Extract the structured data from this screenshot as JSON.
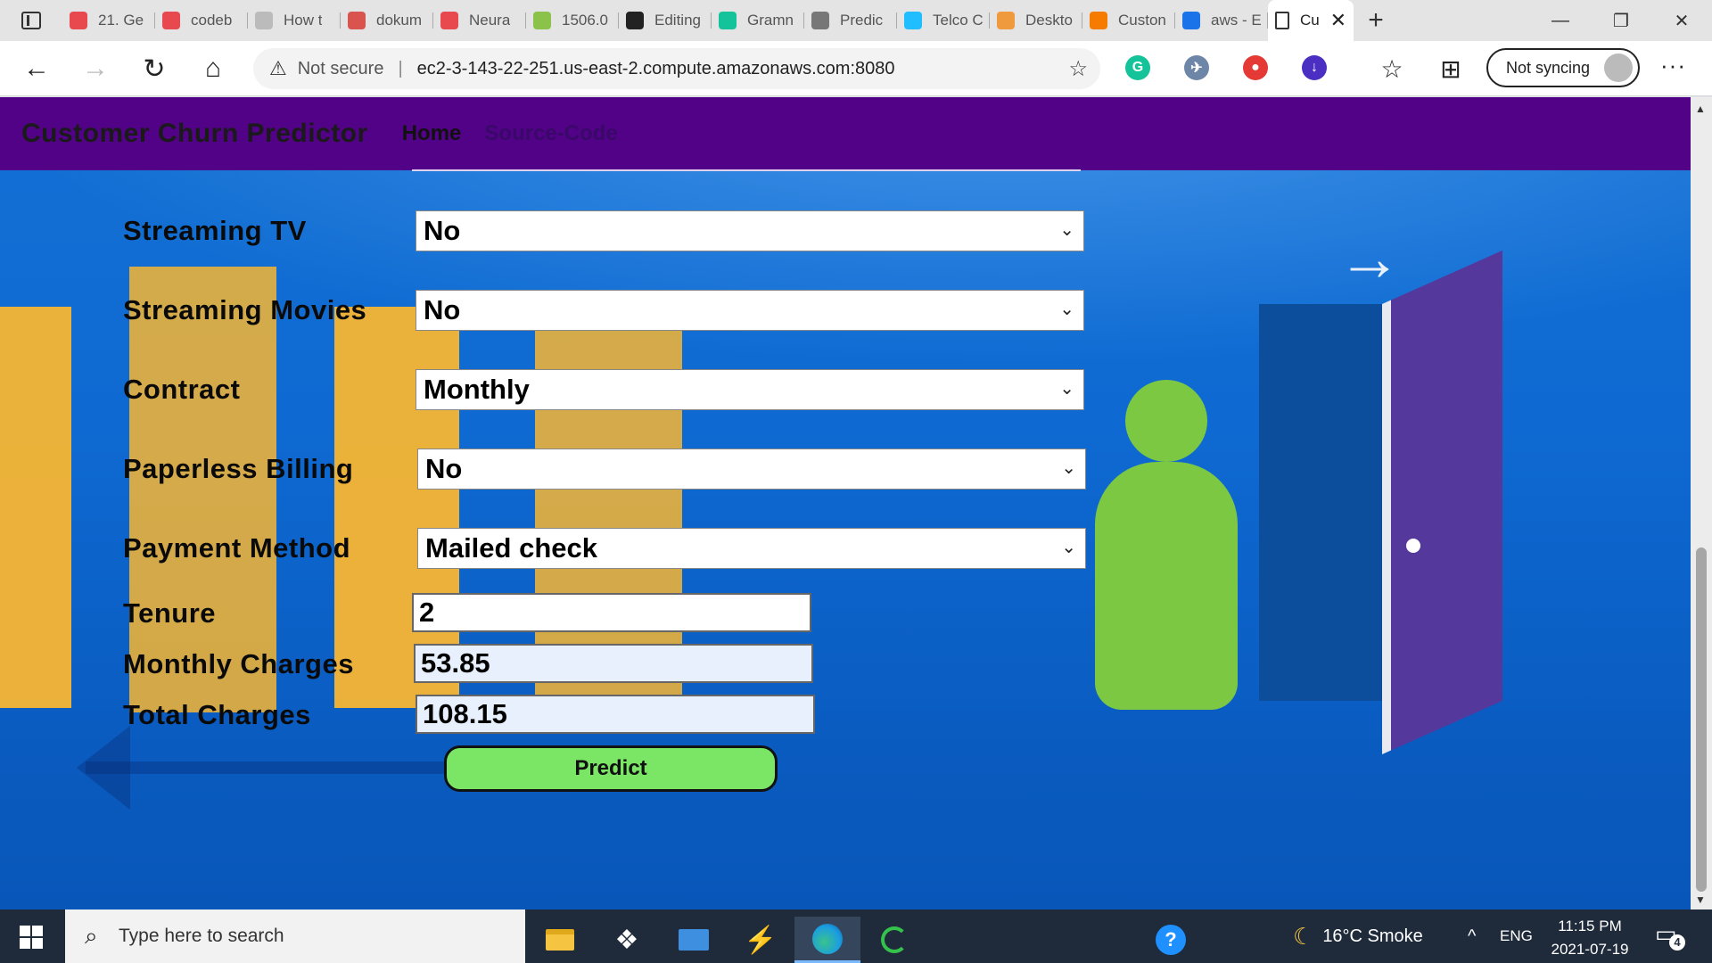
{
  "browser": {
    "tabs": [
      {
        "title": "21. Ge",
        "fav_color": "#e8494f",
        "fav_icon": "youtube-icon"
      },
      {
        "title": "codeb",
        "fav_color": "#e8494f",
        "fav_icon": "youtube-icon"
      },
      {
        "title": "How t",
        "fav_color": "#bbbbbb",
        "fav_icon": "document-icon"
      },
      {
        "title": "dokum",
        "fav_color": "#d9534f",
        "fav_icon": "pdf-icon"
      },
      {
        "title": "Neura",
        "fav_color": "#e8494f",
        "fav_icon": "youtube-icon"
      },
      {
        "title": "1506.0",
        "fav_color": "#8bc34a",
        "fav_icon": "smiley-icon"
      },
      {
        "title": "Editing",
        "fav_color": "#222222",
        "fav_icon": "github-icon"
      },
      {
        "title": "Gramn",
        "fav_color": "#15c39a",
        "fav_icon": "grammarly-icon"
      },
      {
        "title": "Predic",
        "fav_color": "#777777",
        "fav_icon": "tds-icon"
      },
      {
        "title": "Telco C",
        "fav_color": "#20beff",
        "fav_icon": "kaggle-icon"
      },
      {
        "title": "Deskto",
        "fav_color": "#f09a3e",
        "fav_icon": "loading-icon"
      },
      {
        "title": "Custon",
        "fav_color": "#f57c00",
        "fav_icon": "tag-icon"
      },
      {
        "title": "aws - E",
        "fav_color": "#1a73e8",
        "fav_icon": "bing-icon"
      }
    ],
    "active_tab": {
      "title": "Cu",
      "close": "✕"
    },
    "new_tab": "+",
    "window": {
      "minimize": "—",
      "restore": "❐",
      "close": "✕"
    },
    "nav": {
      "back": "←",
      "forward": "→",
      "refresh": "↻",
      "home": "⌂"
    },
    "address": {
      "warning_icon": "⚠",
      "security": "Not secure",
      "separator": "|",
      "url": "ec2-3-143-22-251.us-east-2.compute.amazonaws.com:8080",
      "favorite_icon": "☆"
    },
    "extensions": [
      {
        "name": "grammarly",
        "color": "#15c39a",
        "glyph": "G"
      },
      {
        "name": "satellite",
        "color": "#6d86a8",
        "glyph": "✈"
      },
      {
        "name": "pokeball",
        "color": "#e53935",
        "glyph": "●"
      },
      {
        "name": "download",
        "color": "#4a2fc2",
        "glyph": "↓"
      }
    ],
    "favorites_icon": "☆",
    "collections_icon": "⊞",
    "sync_label": "Not syncing",
    "more": "···"
  },
  "app": {
    "brand": "Customer Churn Predictor",
    "nav_home": "Home",
    "nav_source": "Source-Code",
    "colors": {
      "navbar": "#520287",
      "page": "#1470d4",
      "button": "#7be565"
    }
  },
  "form": {
    "streaming_tv": {
      "label": "Streaming TV",
      "value": "No"
    },
    "streaming_movies": {
      "label": "Streaming Movies",
      "value": "No"
    },
    "contract": {
      "label": "Contract",
      "value": "Monthly"
    },
    "paperless_billing": {
      "label": "Paperless Billing",
      "value": "No"
    },
    "payment_method": {
      "label": "Payment Method",
      "value": "Mailed check"
    },
    "tenure": {
      "label": "Tenure",
      "value": "2"
    },
    "monthly_charges": {
      "label": "Monthly Charges",
      "value": "53.85"
    },
    "total_charges": {
      "label": "Total Charges",
      "value": "108.15"
    },
    "chevron": "⌄",
    "predict_label": "Predict"
  },
  "taskbar": {
    "search_placeholder": "Type here to search",
    "search_icon": "⌕",
    "weather_icon": "☾",
    "weather": "16°C  Smoke",
    "chevron_up": "^",
    "language": "ENG",
    "time": "11:15 PM",
    "date": "2021-07-19",
    "notifications": "4",
    "help_icon": "?"
  }
}
